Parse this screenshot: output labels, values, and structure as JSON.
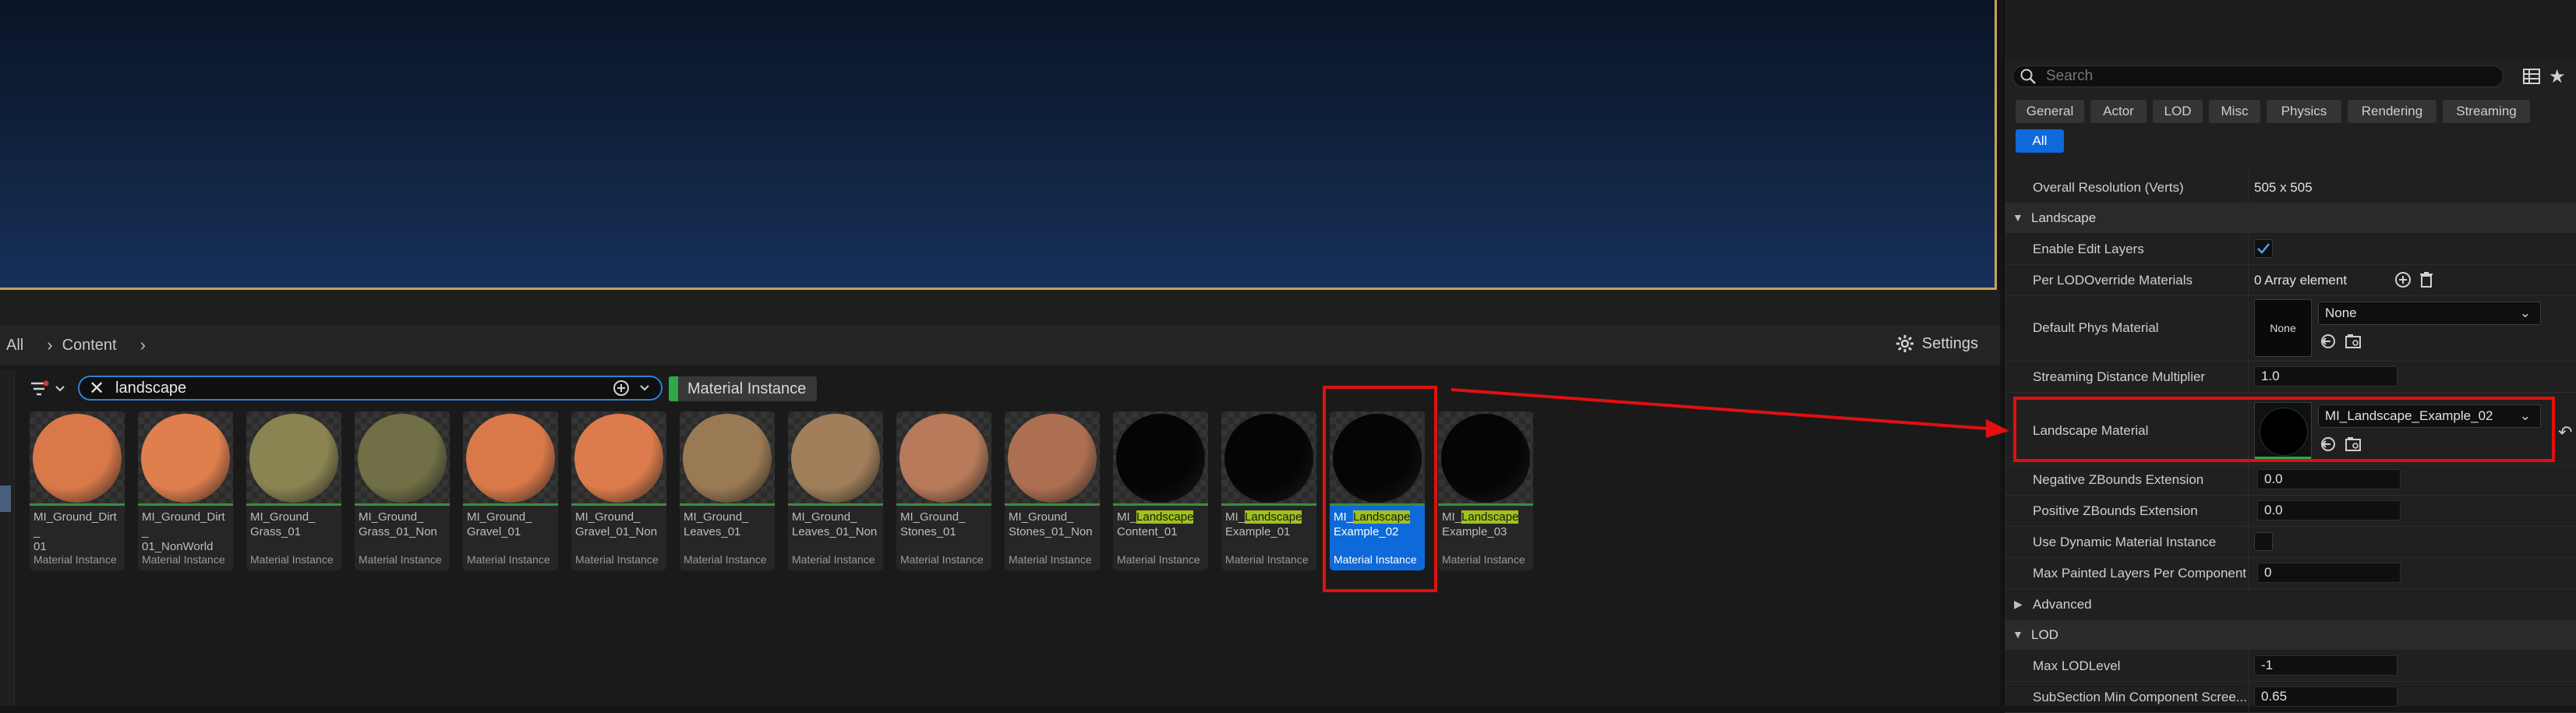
{
  "content_browser": {
    "breadcrumb": [
      "All",
      "Content"
    ],
    "settings_label": "Settings",
    "search": {
      "value": "landscape"
    },
    "filter_chip": "Material Instance",
    "assets": [
      {
        "name_parts": [
          "MI_Ground_Dirt_",
          "01"
        ],
        "type": "Material Instance",
        "color": "#d9794a"
      },
      {
        "name_parts": [
          "MI_Ground_Dirt_",
          "01_NonWorld"
        ],
        "type": "Material Instance",
        "color": "#e07f4e"
      },
      {
        "name_parts": [
          "MI_Ground_",
          "Grass_01"
        ],
        "type": "Material Instance",
        "color": "#8a8352"
      },
      {
        "name_parts": [
          "MI_Ground_",
          "Grass_01_Non"
        ],
        "type": "Material Instance",
        "color": "#706f46"
      },
      {
        "name_parts": [
          "MI_Ground_",
          "Gravel_01"
        ],
        "type": "Material Instance",
        "color": "#d9794a"
      },
      {
        "name_parts": [
          "MI_Ground_",
          "Gravel_01_Non"
        ],
        "type": "Material Instance",
        "color": "#dc7c4c"
      },
      {
        "name_parts": [
          "MI_Ground_",
          "Leaves_01"
        ],
        "type": "Material Instance",
        "color": "#9a7a55"
      },
      {
        "name_parts": [
          "MI_Ground_",
          "Leaves_01_Non"
        ],
        "type": "Material Instance",
        "color": "#a07f5a"
      },
      {
        "name_parts": [
          "MI_Ground_",
          "Stones_01"
        ],
        "type": "Material Instance",
        "color": "#b77a5a"
      },
      {
        "name_parts": [
          "MI_Ground_",
          "Stones_01_Non"
        ],
        "type": "Material Instance",
        "color": "#ad6f52"
      },
      {
        "name_pre": "MI_",
        "name_hl": "Landscape",
        "name_post": "Content_01",
        "type": "Material Instance",
        "color": "#050505"
      },
      {
        "name_pre": "MI_",
        "name_hl": "Landscape",
        "name_post": "Example_01",
        "type": "Material Instance",
        "color": "#050505"
      },
      {
        "name_pre": "MI_",
        "name_hl": "Landscape",
        "name_post": "Example_02",
        "type": "Material Instance",
        "color": "#050505",
        "selected": true
      },
      {
        "name_pre": "MI_",
        "name_hl": "Landscape",
        "name_post": "Example_03",
        "type": "Material Instance",
        "color": "#050505"
      }
    ]
  },
  "details": {
    "search_placeholder": "Search",
    "tabs": [
      "General",
      "Actor",
      "LOD",
      "Misc",
      "Physics",
      "Rendering",
      "Streaming",
      "All"
    ],
    "active_tab": "All",
    "overall_resolution": {
      "label": "Overall Resolution (Verts)",
      "value": "505 x 505"
    },
    "section_landscape": "Landscape",
    "enable_edit_layers": {
      "label": "Enable Edit Layers",
      "checked": true
    },
    "per_lod_override": {
      "label": "Per LODOverride Materials",
      "value": "0 Array element"
    },
    "default_phys_material": {
      "label": "Default Phys Material",
      "thumb": "None",
      "value": "None"
    },
    "streaming_distance": {
      "label": "Streaming Distance Multiplier",
      "value": "1.0"
    },
    "landscape_material": {
      "label": "Landscape Material",
      "value": "MI_Landscape_Example_02"
    },
    "neg_zbounds": {
      "label": "Negative ZBounds Extension",
      "value": "0.0"
    },
    "pos_zbounds": {
      "label": "Positive ZBounds Extension",
      "value": "0.0"
    },
    "use_dynamic_mi": {
      "label": "Use Dynamic Material Instance",
      "checked": false
    },
    "max_painted_layers": {
      "label": "Max Painted Layers Per Component",
      "value": "0"
    },
    "section_advanced": "Advanced",
    "section_lod": "LOD",
    "max_lod_level": {
      "label": "Max LODLevel",
      "value": "-1"
    },
    "subsection_min": {
      "label": "SubSection Min Component Scree...",
      "value": "0.65"
    }
  }
}
